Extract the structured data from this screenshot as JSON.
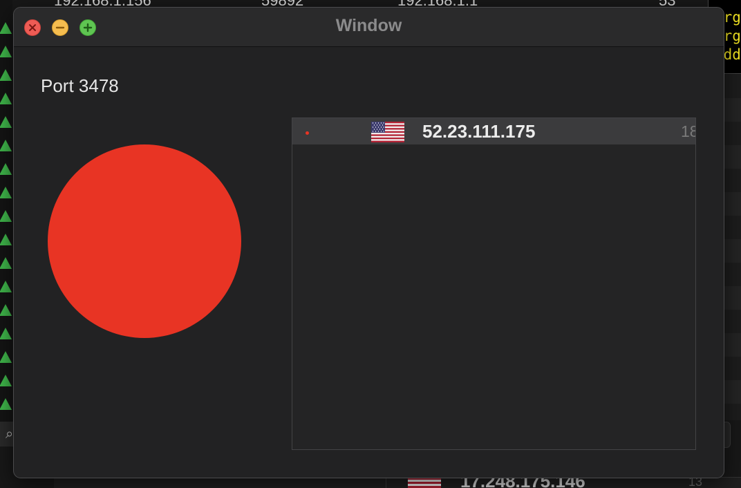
{
  "background_app": {
    "top_row": {
      "source_ip": "192.168.1.156",
      "source_port": "59892",
      "dest_ip": "192.168.1.1",
      "dest_port": "53"
    },
    "bottom_row": {
      "ip": "17.248.175.146",
      "number": "13"
    },
    "search_icon_glyph": "⌕"
  },
  "tooltip": {
    "lines": [
      "Org",
      "Org",
      "Add"
    ],
    "text_color": "#f4e623"
  },
  "window": {
    "title": "Window",
    "port_label": "Port 3478",
    "status_color": "#e83424",
    "connections": [
      {
        "country_flag": "us-flag-icon",
        "ip": "52.23.111.175",
        "number": "18"
      }
    ]
  }
}
